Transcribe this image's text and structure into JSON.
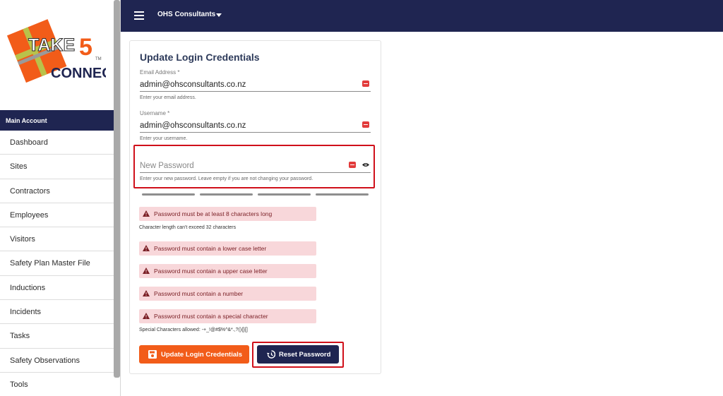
{
  "brand": {
    "logo_text_1": "TAKE",
    "logo_text_2": "5",
    "logo_text_3": "CONNECT",
    "logo_tm": "TM",
    "accent": "#f25c19",
    "navy": "#1f2551"
  },
  "header": {
    "menu_icon": "hamburger-icon",
    "organization": "OHS Consultants"
  },
  "sidebar": {
    "section": "Main Account",
    "items": [
      {
        "label": "Dashboard"
      },
      {
        "label": "Sites"
      },
      {
        "label": "Contractors"
      },
      {
        "label": "Employees"
      },
      {
        "label": "Visitors"
      },
      {
        "label": "Safety Plan Master File"
      },
      {
        "label": "Inductions"
      },
      {
        "label": "Incidents"
      },
      {
        "label": "Tasks"
      },
      {
        "label": "Safety Observations"
      },
      {
        "label": "Tools"
      }
    ]
  },
  "form": {
    "title": "Update Login Credentials",
    "email": {
      "label": "Email Address *",
      "value": "admin@ohsconsultants.co.nz",
      "hint": "Enter your email address."
    },
    "username": {
      "label": "Username *",
      "value": "admin@ohsconsultants.co.nz",
      "hint": "Enter your username."
    },
    "password": {
      "placeholder": "New Password",
      "hint": "Enter your new password. Leave empty if you are not changing your password."
    },
    "rules": [
      {
        "text": "Password must be at least 8 characters long"
      },
      {
        "text": "Password must contain a lower case letter"
      },
      {
        "text": "Password must contain a upper case letter"
      },
      {
        "text": "Password must contain a number"
      },
      {
        "text": "Password must contain a special character"
      }
    ],
    "length_note": "Character length can't exceed 32 characters",
    "special_note": "Special Characters allowed: -+_!@#$%^&*.,?(){}[]",
    "submit_label": "Update Login Credentials",
    "reset_label": "Reset Password"
  }
}
